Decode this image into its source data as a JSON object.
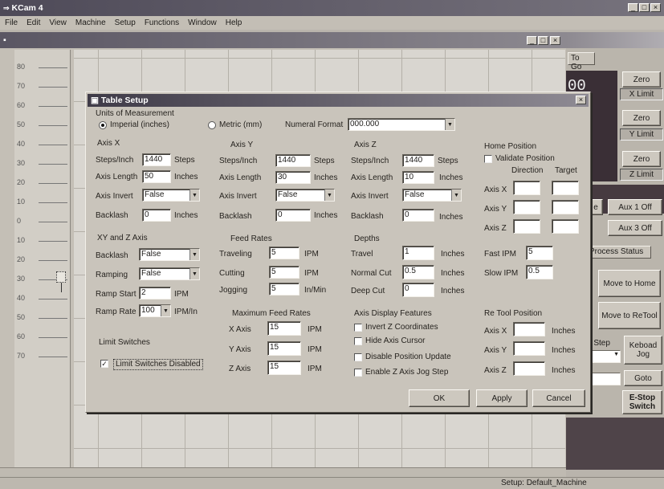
{
  "app": {
    "title": "KCam 4",
    "menu": [
      "File",
      "Edit",
      "View",
      "Machine",
      "Setup",
      "Functions",
      "Window",
      "Help"
    ]
  },
  "doc": {
    "ruler_marks": [
      "80",
      "70",
      "60",
      "50",
      "40",
      "30",
      "20",
      "10",
      "0",
      "10",
      "20",
      "30",
      "40",
      "50",
      "60",
      "70"
    ]
  },
  "right_panel": {
    "tab": "To Go",
    "readout": "00",
    "axes": [
      {
        "zero": "Zero",
        "limit": "X Limit"
      },
      {
        "zero": "Zero",
        "limit": "Y Limit"
      },
      {
        "zero": "Zero",
        "limit": "Z Limit"
      }
    ],
    "aux1": "Aux 1 Off",
    "aux3": "Aux 3 Off",
    "e_label": "e",
    "process_tab": "Process Status",
    "move_home": "Move to Home",
    "move_retool": "Move to ReTool",
    "step_label": "e Step",
    "keyboard_jog": "Keboad Jog",
    "goto": "Goto",
    "estop": "E-Stop Switch"
  },
  "status": {
    "text": "Setup: Default_Machine"
  },
  "dialog": {
    "title": "Table Setup",
    "units": {
      "group": "Units of Measurement",
      "imperial": "Imperial (inches)",
      "metric": "Metric (mm)",
      "format_label": "Numeral Format",
      "format_value": "000.000"
    },
    "axis_x": {
      "group": "Axis X",
      "steps_label": "Steps/Inch",
      "steps": "1440",
      "steps_unit": "Steps",
      "len_label": "Axis Length",
      "len": "50",
      "len_unit": "Inches",
      "inv_label": "Axis Invert",
      "inv": "False",
      "back_label": "Backlash",
      "back": "0",
      "back_unit": "Inches"
    },
    "axis_y": {
      "group": "Axis Y",
      "steps_label": "Steps/Inch",
      "steps": "1440",
      "steps_unit": "Steps",
      "len_label": "Axis Length",
      "len": "30",
      "len_unit": "Inches",
      "inv_label": "Axis Invert",
      "inv": "False",
      "back_label": "Backlash",
      "back": "0",
      "back_unit": "Inches"
    },
    "axis_z": {
      "group": "Axis Z",
      "steps_label": "Steps/Inch",
      "steps": "1440",
      "steps_unit": "Steps",
      "len_label": "Axis Length",
      "len": "10",
      "len_unit": "Inches",
      "inv_label": "Axis Invert",
      "inv": "False",
      "back_label": "Backlash",
      "back": "0",
      "back_unit": "Inches"
    },
    "home": {
      "group": "Home Position",
      "validate": "Validate Position",
      "direction": "Direction",
      "target": "Target",
      "ax": "Axis X",
      "ay": "Axis Y",
      "az": "Axis Z"
    },
    "xyz": {
      "group": "XY and Z Axis",
      "back_label": "Backlash",
      "back": "False",
      "ramp_label": "Ramping",
      "ramp": "False",
      "start_label": "Ramp Start",
      "start": "2",
      "start_unit": "IPM",
      "rate_label": "Ramp Rate",
      "rate": "100",
      "rate_unit": "IPM/In"
    },
    "feed": {
      "group": "Feed Rates",
      "trav_label": "Traveling",
      "trav": "5",
      "trav_unit": "IPM",
      "cut_label": "Cutting",
      "cut": "5",
      "cut_unit": "IPM",
      "jog_label": "Jogging",
      "jog": "5",
      "jog_unit": "In/Min"
    },
    "depths": {
      "group": "Depths",
      "trav_label": "Travel",
      "trav": "1",
      "trav_unit": "Inches",
      "norm_label": "Normal Cut",
      "norm": "0.5",
      "norm_unit": "Inches",
      "deep_label": "Deep Cut",
      "deep": "0",
      "deep_unit": "Inches"
    },
    "ipm": {
      "fast_label": "Fast IPM",
      "fast": "5",
      "slow_label": "Slow IPM",
      "slow": "0.5"
    },
    "limits": {
      "group": "Limit Switches",
      "disabled": "Limit Switches Disabled"
    },
    "maxfeed": {
      "group": "Maximum Feed Rates",
      "x_label": "X Axis",
      "x": "15",
      "x_unit": "IPM",
      "y_label": "Y Axis",
      "y": "15",
      "y_unit": "IPM",
      "z_label": "Z Axis",
      "z": "15",
      "z_unit": "IPM"
    },
    "display": {
      "group": "Axis Display Features",
      "opt1": "Invert Z Coordinates",
      "opt2": "Hide Axis Cursor",
      "opt3": "Disable Position Update",
      "opt4": "Enable Z Axis Jog Step"
    },
    "retool": {
      "group": "Re Tool Position",
      "ax": "Axis X",
      "ay": "Axis Y",
      "az": "Axis Z",
      "unit": "Inches"
    },
    "ok": "OK",
    "apply": "Apply",
    "cancel": "Cancel"
  }
}
